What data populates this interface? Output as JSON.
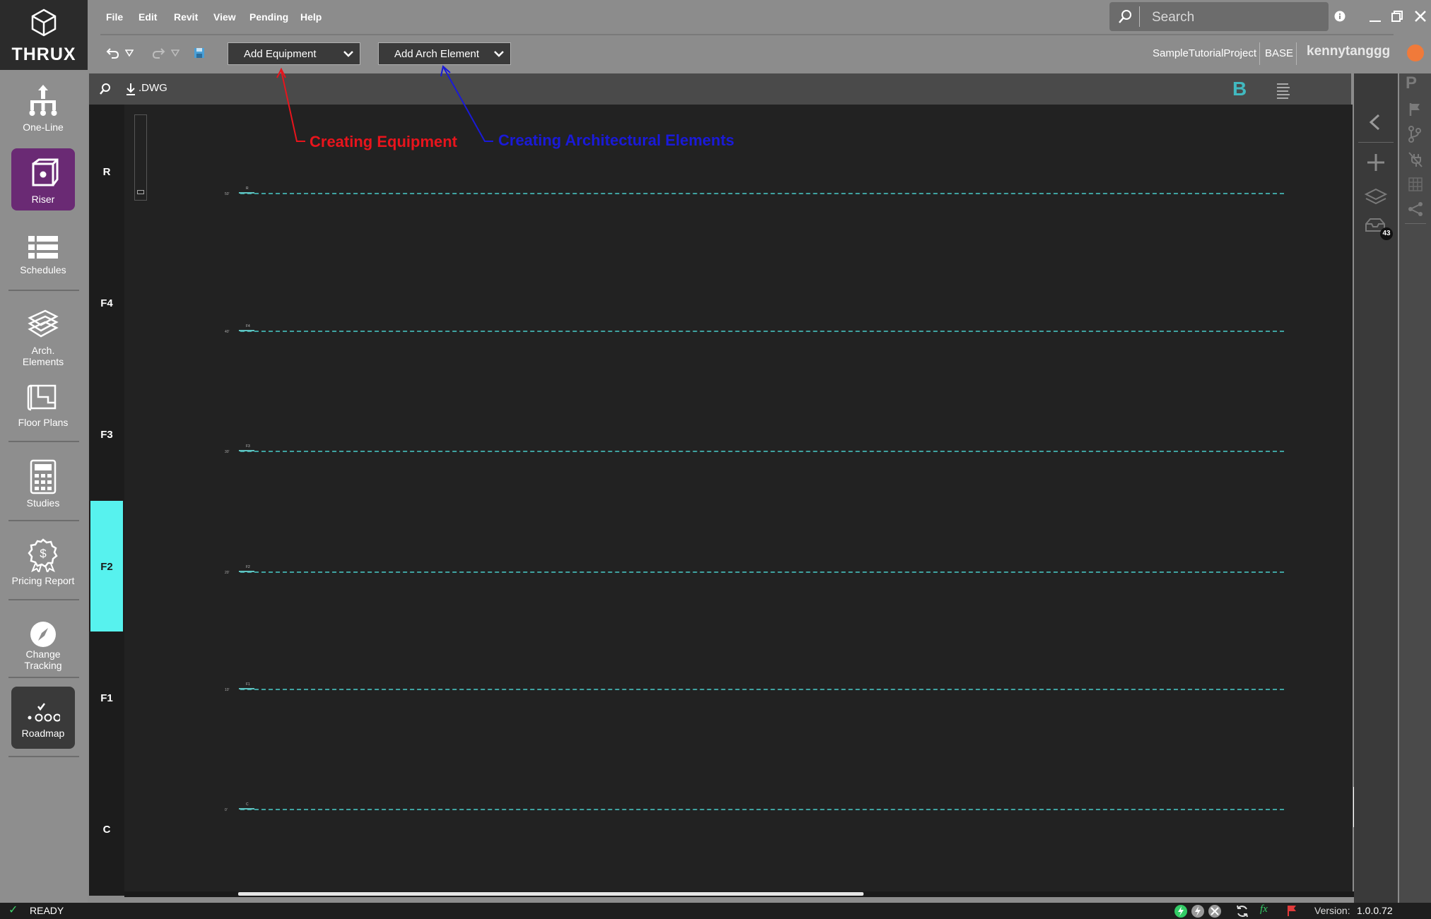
{
  "app": {
    "logo_text": "THRUX"
  },
  "sidebar": {
    "items": [
      {
        "label": "One-Line"
      },
      {
        "label": "Riser"
      },
      {
        "label": "Schedules"
      },
      {
        "label": "Arch. Elements"
      },
      {
        "label": "Floor Plans"
      },
      {
        "label": "Studies"
      },
      {
        "label": "Pricing Report"
      },
      {
        "label": "Change Tracking"
      },
      {
        "label": "Roadmap"
      }
    ]
  },
  "menu": {
    "items": [
      "File",
      "Edit",
      "Revit",
      "View",
      "Pending",
      "Help"
    ]
  },
  "search": {
    "placeholder": "Search"
  },
  "toolbar": {
    "add_equipment": "Add Equipment",
    "add_arch_element": "Add Arch Element",
    "project_name": "SampleTutorialProject",
    "branch": "BASE",
    "username": "kennytanggg"
  },
  "canvas_bar": {
    "dwg_label": ".DWG",
    "bold_label": "B"
  },
  "levels": [
    {
      "label": "R",
      "tag": "R",
      "elev": "50'"
    },
    {
      "label": "F4",
      "tag": "F4",
      "elev": "40'"
    },
    {
      "label": "F3",
      "tag": "F3",
      "elev": "30'"
    },
    {
      "label": "F2",
      "tag": "F2",
      "elev": "20'",
      "highlighted": true
    },
    {
      "label": "F1",
      "tag": "F1",
      "elev": "10'"
    },
    {
      "label": "C",
      "tag": "C",
      "elev": "0'"
    }
  ],
  "annotations": {
    "equipment": "Creating Equipment",
    "arch": "Creating Architectural Elements",
    "equipment_color": "#e8141c",
    "arch_color": "#1a1ad8"
  },
  "right_panel": {
    "badge_count": "43"
  },
  "status": {
    "state": "READY",
    "version_label": "Version:",
    "version": "1.0.0.72"
  },
  "colors": {
    "accent_purple": "#6a2a74",
    "level_highlight": "#57f2ee",
    "grid_line": "#3fa3a1"
  }
}
